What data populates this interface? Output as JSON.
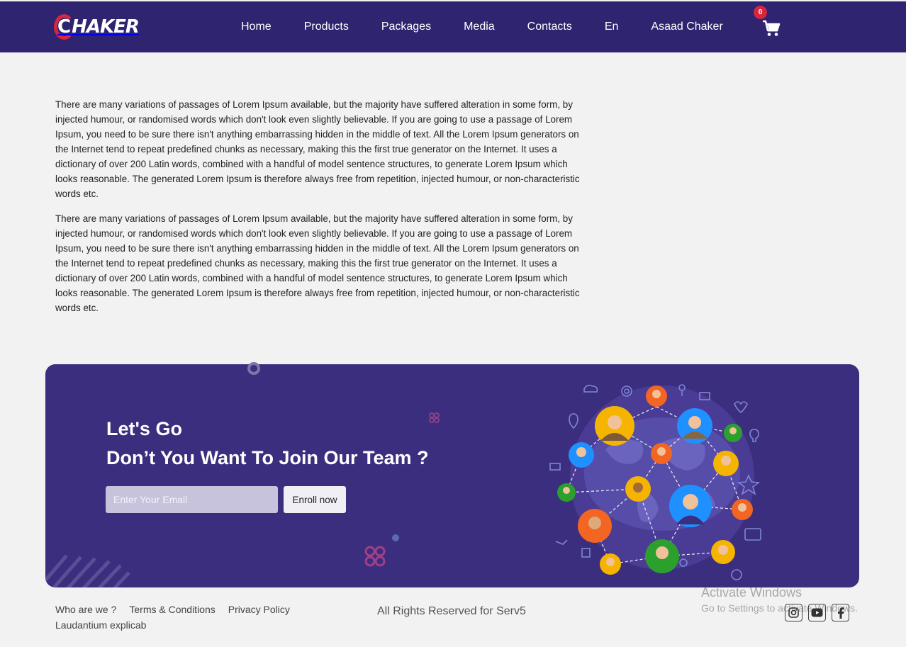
{
  "brand": {
    "logo_letter": "C",
    "logo_text": "HAKER",
    "accent": "#d7263d",
    "nav_bg": "#2f2470"
  },
  "nav": {
    "items": [
      {
        "label": "Home"
      },
      {
        "label": "Products"
      },
      {
        "label": "Packages"
      },
      {
        "label": "Media"
      },
      {
        "label": "Contacts"
      },
      {
        "label": "En"
      },
      {
        "label": "Asaad Chaker"
      }
    ],
    "cart_count": "0",
    "cart_icon": "shopping-cart-icon"
  },
  "content": {
    "paragraphs": [
      "There are many variations of passages of Lorem Ipsum available, but the majority have suffered alteration in some form, by injected humour, or randomised words which don't look even slightly believable. If you are going to use a passage of Lorem Ipsum, you need to be sure there isn't anything embarrassing hidden in the middle of text. All the Lorem Ipsum generators on the Internet tend to repeat predefined chunks as necessary, making this the first true generator on the Internet. It uses a dictionary of over 200 Latin words, combined with a handful of model sentence structures, to generate Lorem Ipsum which looks reasonable. The generated Lorem Ipsum is therefore always free from repetition, injected humour, or non-characteristic words etc.",
      "There are many variations of passages of Lorem Ipsum available, but the majority have suffered alteration in some form, by injected humour, or randomised words which don't look even slightly believable. If you are going to use a passage of Lorem Ipsum, you need to be sure there isn't anything embarrassing hidden in the middle of text. All the Lorem Ipsum generators on the Internet tend to repeat predefined chunks as necessary, making this the first true generator on the Internet. It uses a dictionary of over 200 Latin words, combined with a handful of model sentence structures, to generate Lorem Ipsum which looks reasonable. The generated Lorem Ipsum is therefore always free from repetition, injected humour, or non-characteristic words etc."
    ]
  },
  "banner": {
    "heading_1": "Let's Go",
    "heading_2": "Don’t You Want To Join Our Team ?",
    "email_placeholder": "Enter Your Email",
    "enroll_label": "Enroll now",
    "bg": "#3b2e7e"
  },
  "footer": {
    "links": [
      "Who are we ?",
      "Terms & Conditions",
      "Privacy Policy"
    ],
    "link_2": "Laudantium explicab",
    "copyright": "All Rights Reserved for Serv5",
    "social": [
      "instagram-icon",
      "youtube-icon",
      "facebook-icon"
    ]
  },
  "watermark": {
    "title": "Activate Windows",
    "subtitle": "Go to Settings to activate Windows."
  }
}
